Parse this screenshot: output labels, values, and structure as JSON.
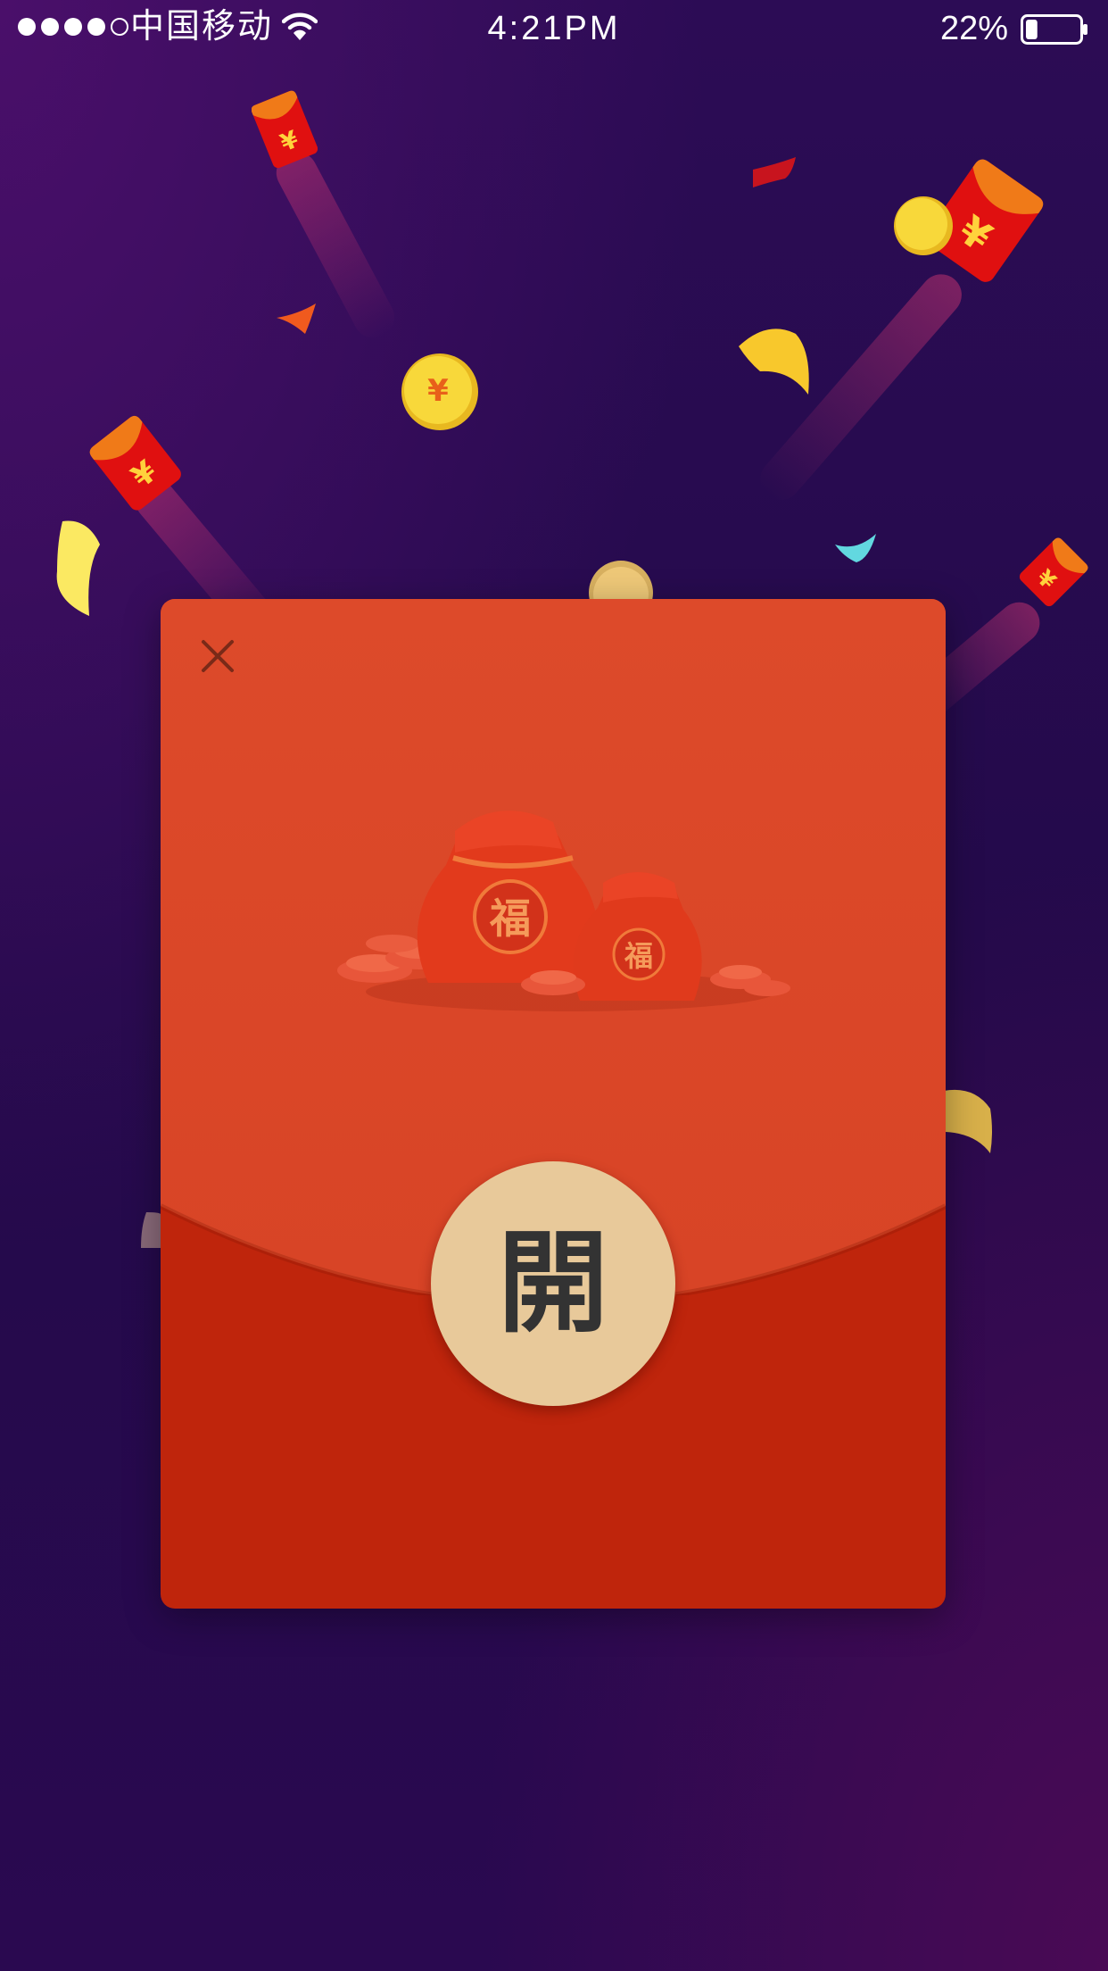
{
  "status_bar": {
    "carrier": "中国移动",
    "time": "4:21PM",
    "battery_percent": "22%",
    "battery_level": 0.22,
    "signal_bars_filled": 4,
    "signal_bars_total": 5
  },
  "red_packet": {
    "open_label": "開",
    "bag_character": "福",
    "envelope_symbol": "¥"
  },
  "colors": {
    "packet_top": "#dc4628",
    "packet_bottom": "#bf250c",
    "open_button": "#e8c99a",
    "coin": "#f5d230",
    "envelope": "#e01010"
  },
  "icons": {
    "close": "close-icon",
    "wifi": "wifi-icon",
    "battery": "battery-icon"
  }
}
